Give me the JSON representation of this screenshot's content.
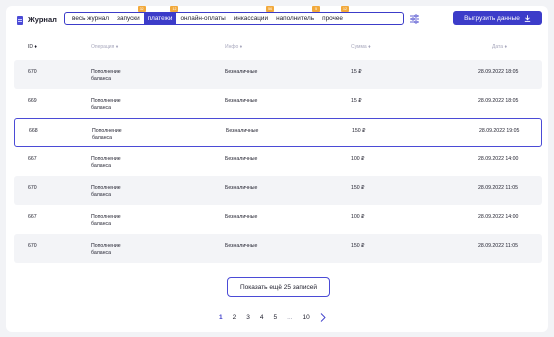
{
  "header": {
    "title": "Журнал",
    "tabs": [
      {
        "label": "весь журнал",
        "badge": "",
        "active": false
      },
      {
        "label": "запуски",
        "badge": "32",
        "active": false
      },
      {
        "label": "платежи",
        "badge": "12",
        "active": true
      },
      {
        "label": "онлайн-оплаты",
        "badge": "",
        "active": false
      },
      {
        "label": "инкассации",
        "badge": "56",
        "active": false
      },
      {
        "label": "наполнитель",
        "badge": "5",
        "active": false
      },
      {
        "label": "прочее",
        "badge": "12",
        "active": false
      }
    ],
    "export_label": "Выгрузить данные",
    "accent": "#3c3cc9",
    "badge_color": "#f2a93b"
  },
  "table": {
    "columns": {
      "id": "ID ♦",
      "operation": "Операция ♦",
      "info": "Инфо ♦",
      "sum": "Сумма ♦",
      "date": "Дата ♦"
    },
    "rows": [
      {
        "id": "670",
        "operation": "Пополнение баланса",
        "info": "Безналичные",
        "sum": "15 ₽",
        "date": "28.09.2022 18:05",
        "style": "shaded"
      },
      {
        "id": "669",
        "operation": "Пополнение баланса",
        "info": "Безналичные",
        "sum": "15 ₽",
        "date": "28.09.2022 18:05",
        "style": "plain"
      },
      {
        "id": "668",
        "operation": "Пополнение баланса",
        "info": "Безналичные",
        "sum": "150 ₽",
        "date": "28.09.2022 19:05",
        "style": "selected"
      },
      {
        "id": "667",
        "operation": "Пополнение баланса",
        "info": "Безналичные",
        "sum": "100 ₽",
        "date": "28.09.2022 14:00",
        "style": "plain"
      },
      {
        "id": "670",
        "operation": "Пополнение баланса",
        "info": "Безналичные",
        "sum": "150 ₽",
        "date": "28.09.2022 11:05",
        "style": "shaded"
      },
      {
        "id": "667",
        "operation": "Пополнение баланса",
        "info": "Безналичные",
        "sum": "100 ₽",
        "date": "28.09.2022 14:00",
        "style": "plain"
      },
      {
        "id": "670",
        "operation": "Пополнение баланса",
        "info": "Безналичные",
        "sum": "150 ₽",
        "date": "28.09.2022 11:05",
        "style": "shaded"
      }
    ]
  },
  "more_label": "Показать ещё 25 записей",
  "pagination": {
    "pages": [
      "1",
      "2",
      "3",
      "4",
      "5"
    ],
    "ellipsis": "...",
    "last": "10",
    "current": "1"
  }
}
